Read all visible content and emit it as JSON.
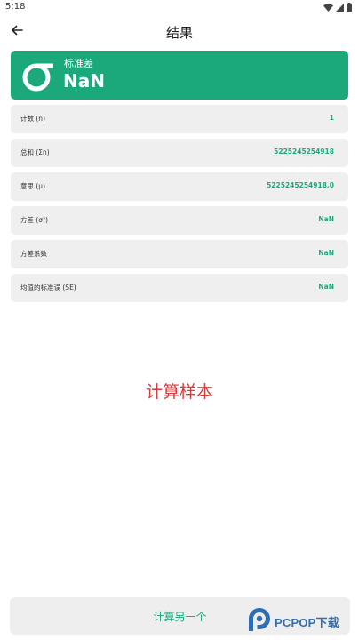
{
  "status_bar": {
    "time": "5:18"
  },
  "app_bar": {
    "title": "结果"
  },
  "hero": {
    "label": "标准差",
    "value": "NaN"
  },
  "results": [
    {
      "label": "计数 (n)",
      "value": "1"
    },
    {
      "label": "总和 (Σn)",
      "value": "5225245254918"
    },
    {
      "label": "意思 (μ)",
      "value": "5225245254918.0"
    },
    {
      "label": "方差 (σ²)",
      "value": "NaN"
    },
    {
      "label": "方差系数",
      "value": "NaN"
    },
    {
      "label": "均值的标准误 (SE)",
      "value": "NaN"
    }
  ],
  "center_caption": "计算样本",
  "bottom_button": {
    "label": "计算另一个"
  },
  "watermark": {
    "brand": "PCPOP下载"
  },
  "colors": {
    "accent_green": "#1ba97c",
    "caption_red": "#d93a3a",
    "row_background": "#efefef"
  }
}
